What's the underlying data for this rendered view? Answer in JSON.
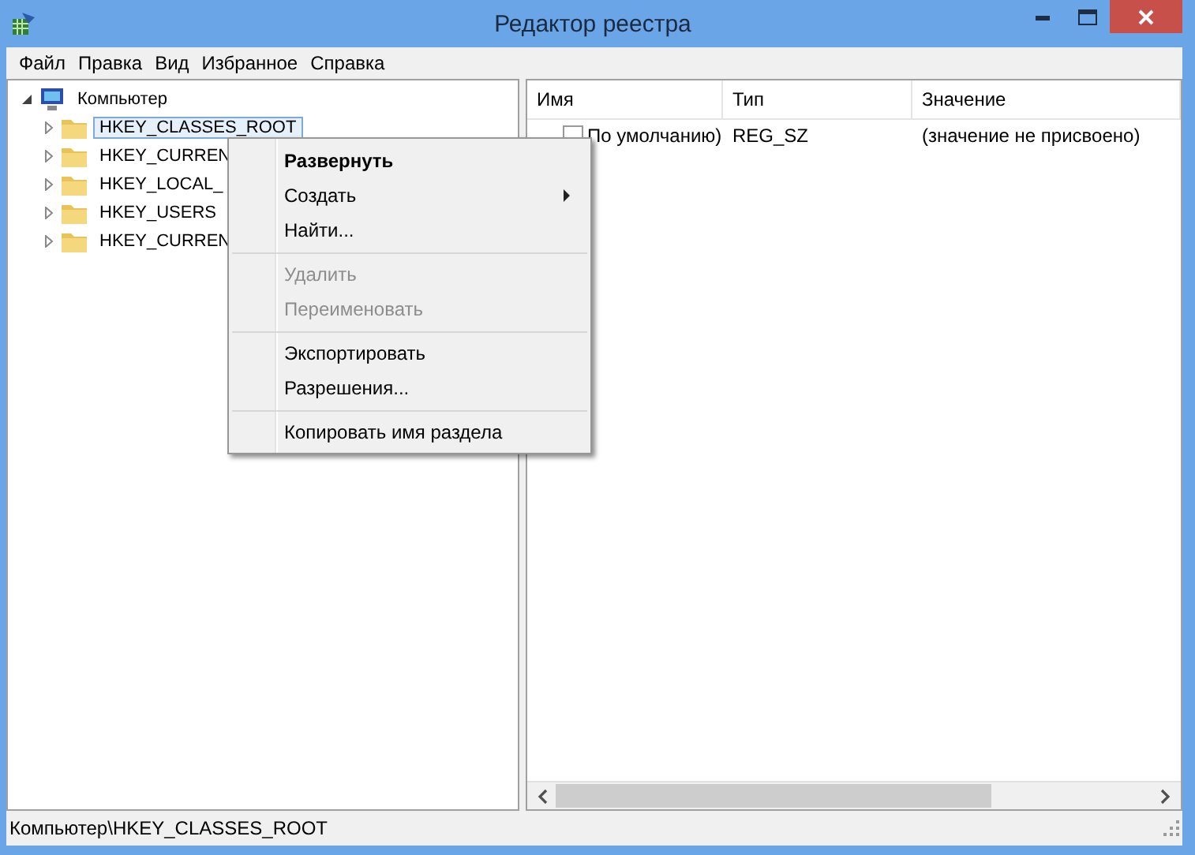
{
  "window": {
    "title": "Редактор реестра"
  },
  "menu_bar": [
    "Файл",
    "Правка",
    "Вид",
    "Избранное",
    "Справка"
  ],
  "tree": [
    {
      "label": "Компьютер",
      "kind": "computer",
      "expanded": true,
      "selected": false,
      "children": [
        {
          "label": "HKEY_CLASSES_ROOT",
          "kind": "folder",
          "expanded": false,
          "selected": true
        },
        {
          "label": "HKEY_CURREN",
          "kind": "folder",
          "expanded": false,
          "selected": false
        },
        {
          "label": "HKEY_LOCAL_",
          "kind": "folder",
          "expanded": false,
          "selected": false
        },
        {
          "label": "HKEY_USERS",
          "kind": "folder",
          "expanded": false,
          "selected": false
        },
        {
          "label": "HKEY_CURREN",
          "kind": "folder",
          "expanded": false,
          "selected": false
        }
      ]
    }
  ],
  "table": {
    "columns": [
      "Имя",
      "Тип",
      "Значение"
    ],
    "rows": [
      [
        "По умолчанию)",
        "REG_SZ",
        "(значение не присвоено)"
      ]
    ]
  },
  "context_menu": [
    [
      {
        "label": "Развернуть",
        "default": true,
        "disabled": false,
        "submenu": false
      },
      {
        "label": "Создать",
        "default": false,
        "disabled": false,
        "submenu": true
      },
      {
        "label": "Найти...",
        "default": false,
        "disabled": false,
        "submenu": false
      }
    ],
    [
      {
        "label": "Удалить",
        "default": false,
        "disabled": true,
        "submenu": false
      },
      {
        "label": "Переименовать",
        "default": false,
        "disabled": true,
        "submenu": false
      }
    ],
    [
      {
        "label": "Экспортировать",
        "default": false,
        "disabled": false,
        "submenu": false
      },
      {
        "label": "Разрешения...",
        "default": false,
        "disabled": false,
        "submenu": false
      }
    ],
    [
      {
        "label": "Копировать имя раздела",
        "default": false,
        "disabled": false,
        "submenu": false
      }
    ]
  ],
  "status_bar": "Компьютер\\HKEY_CLASSES_ROOT"
}
